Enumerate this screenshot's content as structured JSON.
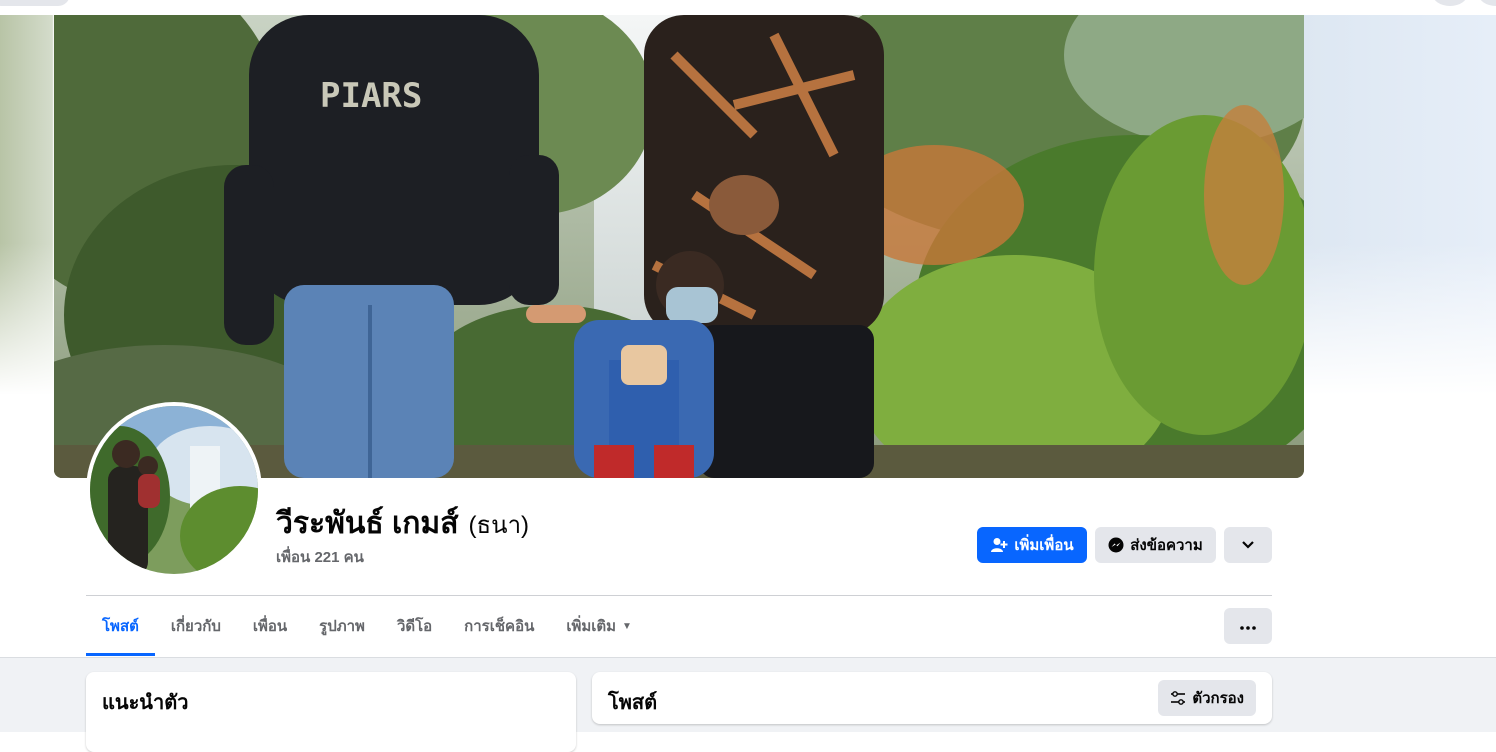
{
  "profile": {
    "name": "วีระพันธ์ เกมส์",
    "alternate_name": "(ธนา)",
    "friends_count": "เพื่อน 221 คน",
    "cover_shirt_text": "PIARS"
  },
  "actions": {
    "add_friend": "เพิ่มเพื่อน",
    "message": "ส่งข้อความ"
  },
  "tabs": [
    {
      "label": "โพสต์",
      "active": true
    },
    {
      "label": "เกี่ยวกับ",
      "active": false
    },
    {
      "label": "เพื่อน",
      "active": false
    },
    {
      "label": "รูปภาพ",
      "active": false
    },
    {
      "label": "วิดีโอ",
      "active": false
    },
    {
      "label": "การเช็คอิน",
      "active": false
    },
    {
      "label": "เพิ่มเติม",
      "active": false
    }
  ],
  "cards": {
    "intro_title": "แนะนำตัว",
    "posts_title": "โพสต์",
    "filter_label": "ตัวกรอง"
  },
  "colors": {
    "accent": "#0866ff",
    "button_grey": "#e4e6eb",
    "page_bg": "#f0f2f5",
    "muted_text": "#65676b"
  },
  "icons": {
    "add_friend": "person-plus-icon",
    "message": "messenger-icon",
    "dropdown": "chevron-down-icon",
    "more": "ellipsis-icon",
    "filter": "sliders-icon"
  }
}
